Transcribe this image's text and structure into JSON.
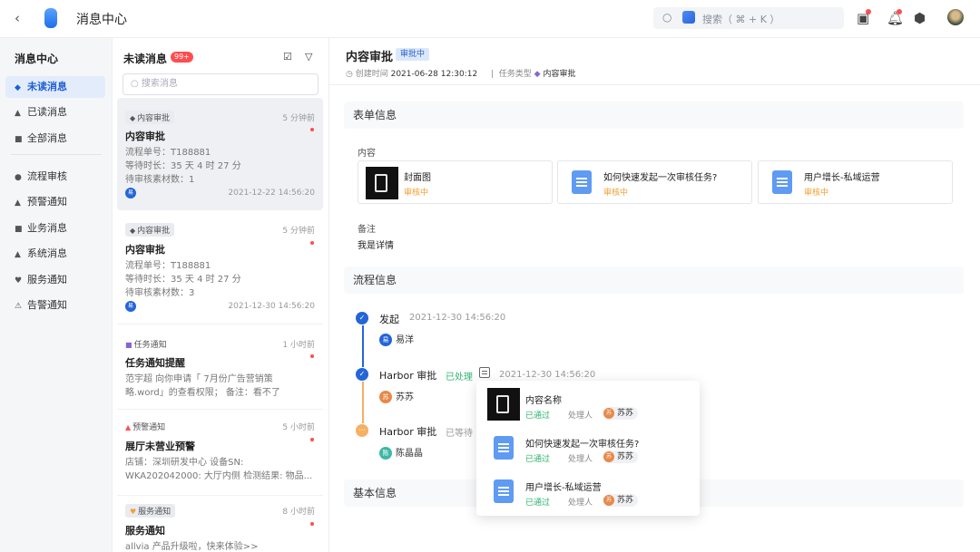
{
  "topbar": {
    "back_icon": "chevron-left-icon",
    "title": "消息中心",
    "search_placeholder": "搜索（ ⌘ + K ）",
    "icons": [
      "task-icon",
      "bell-icon",
      "settings-icon",
      "avatar"
    ]
  },
  "sidebar": {
    "heading": "消息中心",
    "items": [
      {
        "label": "未读消息",
        "icon": "bell-icon",
        "active": true
      },
      {
        "label": "已读消息",
        "icon": "bell-icon"
      },
      {
        "label": "全部消息",
        "icon": "grid-icon"
      },
      {
        "label": "流程审核",
        "icon": "user-icon"
      },
      {
        "label": "预警通知",
        "icon": "bell-icon"
      },
      {
        "label": "业务消息",
        "icon": "grid-icon"
      },
      {
        "label": "系统消息",
        "icon": "bell-icon"
      },
      {
        "label": "服务通知",
        "icon": "heart-icon"
      },
      {
        "label": "告警通知",
        "icon": "warning-icon"
      }
    ]
  },
  "list": {
    "title": "未读消息",
    "count": "99+",
    "search_placeholder": "搜索消息",
    "messages": [
      {
        "tag": "内容审批",
        "time": "5 分钟前",
        "title": "内容审批",
        "lines": [
          "流程单号：T188881",
          "等待时长：35 天 4 时 27 分",
          "待审核素材数：1"
        ],
        "avatar": "易",
        "date": "2021-12-22 14:56:20"
      },
      {
        "tag": "内容审批",
        "time": "5 分钟前",
        "title": "内容审批",
        "lines": [
          "流程单号：T188881",
          "等待时长：35 天 4 时 27 分",
          "待审核素材数：3"
        ],
        "avatar": "易",
        "date": "2021-12-30 14:56:20"
      },
      {
        "tag": "任务通知",
        "time": "1 小时前",
        "title": "任务通知提醒",
        "lines": [
          "范宇超 向你申请「      7月份广告营销策",
          "略.word」的查看权限； 备注：看不了"
        ]
      },
      {
        "tag": "预警通知",
        "time": "5 小时前",
        "title": "展厅未营业预警",
        "lines": [
          "店铺：深圳研发中心 设备SN:",
          "WKA202042000: 大厅内侧 检测结果: 物品..."
        ]
      },
      {
        "tag": "服务通知",
        "time": "8 小时前",
        "title": "服务通知",
        "lines": [
          "allvia       产品升级啦，快来体验>>"
        ]
      }
    ]
  },
  "detail": {
    "title": "内容审批",
    "status": "审批中",
    "created_label": "创建时间",
    "created_value": "2021-06-28 12:30:12",
    "type_label": "任务类型",
    "type_value": "内容审批",
    "form_section": "表单信息",
    "content_label": "内容",
    "cards": [
      {
        "name": "封面图",
        "status": "审核中"
      },
      {
        "name": "如何快速发起一次审核任务?",
        "status": "审核中"
      },
      {
        "name": "用户增长-私域运营",
        "status": "审核中"
      }
    ],
    "remark_label": "备注",
    "remark_value": "我是详情",
    "flow_section": "流程信息",
    "steps": [
      {
        "title": "发起",
        "time": "2021-12-30 14:56:20",
        "person": "易洋",
        "avatar": "易"
      },
      {
        "title": "Harbor 审批",
        "state": "已处理",
        "time": "2021-12-30 14:56:20",
        "person": "苏苏",
        "avatar": "苏"
      },
      {
        "title": "Harbor 审批",
        "state": "已等待",
        "person": "陈晶晶",
        "avatar": "陈"
      }
    ],
    "basic_section": "基本信息"
  },
  "popover": {
    "items": [
      {
        "name": "内容名称",
        "status": "已通过",
        "handler_label": "处理人",
        "handler": "苏苏",
        "avatar": "苏"
      },
      {
        "name": "如何快速发起一次审核任务?",
        "status": "已通过",
        "handler_label": "处理人",
        "handler": "苏苏",
        "avatar": "苏"
      },
      {
        "name": "用户增长-私域运营",
        "status": "已通过",
        "handler_label": "处理人",
        "handler": "苏苏",
        "avatar": "苏"
      }
    ]
  },
  "colors": {
    "accent": "#2465d8",
    "warning": "#f0a033",
    "success": "#2fb36d",
    "danger": "#ff4d4f"
  }
}
